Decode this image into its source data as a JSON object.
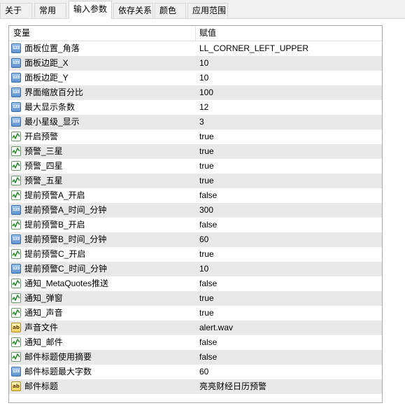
{
  "tabs": [
    {
      "label": "关于"
    },
    {
      "label": "常用"
    },
    {
      "label": "输入参数"
    },
    {
      "label": "依存关系"
    },
    {
      "label": "颜色"
    },
    {
      "label": "应用范围"
    }
  ],
  "table": {
    "columns": {
      "variable": "变量",
      "value": "赋值"
    },
    "rows": [
      {
        "icon": "number-icon",
        "icon_text": "123",
        "name": "面板位置_角落",
        "value": "LL_CORNER_LEFT_UPPER"
      },
      {
        "icon": "number-icon",
        "icon_text": "123",
        "name": "面板边距_X",
        "value": "10"
      },
      {
        "icon": "number-icon",
        "icon_text": "123",
        "name": "面板边距_Y",
        "value": "10"
      },
      {
        "icon": "number-icon",
        "icon_text": "123",
        "name": "界面缩放百分比",
        "value": "100"
      },
      {
        "icon": "number-icon",
        "icon_text": "123",
        "name": "最大显示条数",
        "value": "12"
      },
      {
        "icon": "number-icon",
        "icon_text": "123",
        "name": "最小星级_显示",
        "value": "3"
      },
      {
        "icon": "boolean-icon",
        "icon_text": "",
        "name": "开启预警",
        "value": "true"
      },
      {
        "icon": "boolean-icon",
        "icon_text": "",
        "name": "预警_三星",
        "value": "true"
      },
      {
        "icon": "boolean-icon",
        "icon_text": "",
        "name": "预警_四星",
        "value": "true"
      },
      {
        "icon": "boolean-icon",
        "icon_text": "",
        "name": "预警_五星",
        "value": "true"
      },
      {
        "icon": "boolean-icon",
        "icon_text": "",
        "name": "提前预警A_开启",
        "value": "false"
      },
      {
        "icon": "number-icon",
        "icon_text": "123",
        "name": "提前预警A_时间_分钟",
        "value": "300"
      },
      {
        "icon": "boolean-icon",
        "icon_text": "",
        "name": "提前预警B_开启",
        "value": "false"
      },
      {
        "icon": "number-icon",
        "icon_text": "123",
        "name": "提前预警B_时间_分钟",
        "value": "60"
      },
      {
        "icon": "boolean-icon",
        "icon_text": "",
        "name": "提前预警C_开启",
        "value": "true"
      },
      {
        "icon": "number-icon",
        "icon_text": "123",
        "name": "提前预警C_时间_分钟",
        "value": "10"
      },
      {
        "icon": "boolean-icon",
        "icon_text": "",
        "name": "通知_MetaQuotes推送",
        "value": "false"
      },
      {
        "icon": "boolean-icon",
        "icon_text": "",
        "name": "通知_弹窗",
        "value": "true"
      },
      {
        "icon": "boolean-icon",
        "icon_text": "",
        "name": "通知_声音",
        "value": "true"
      },
      {
        "icon": "string-icon",
        "icon_text": "ab",
        "name": "声音文件",
        "value": "alert.wav"
      },
      {
        "icon": "boolean-icon",
        "icon_text": "",
        "name": "通知_邮件",
        "value": "false"
      },
      {
        "icon": "boolean-icon",
        "icon_text": "",
        "name": "邮件标题使用摘要",
        "value": "false"
      },
      {
        "icon": "number-icon",
        "icon_text": "123",
        "name": "邮件标题最大字数",
        "value": "60"
      },
      {
        "icon": "string-icon",
        "icon_text": "ab",
        "name": "邮件标题",
        "value": "亮亮财经日历预警"
      }
    ]
  },
  "colors": {
    "row_alt": "#e8e8e8",
    "number_icon": "#5e92cf",
    "boolean_icon": "#2e8b2e",
    "string_icon": "#f2cf5a"
  }
}
